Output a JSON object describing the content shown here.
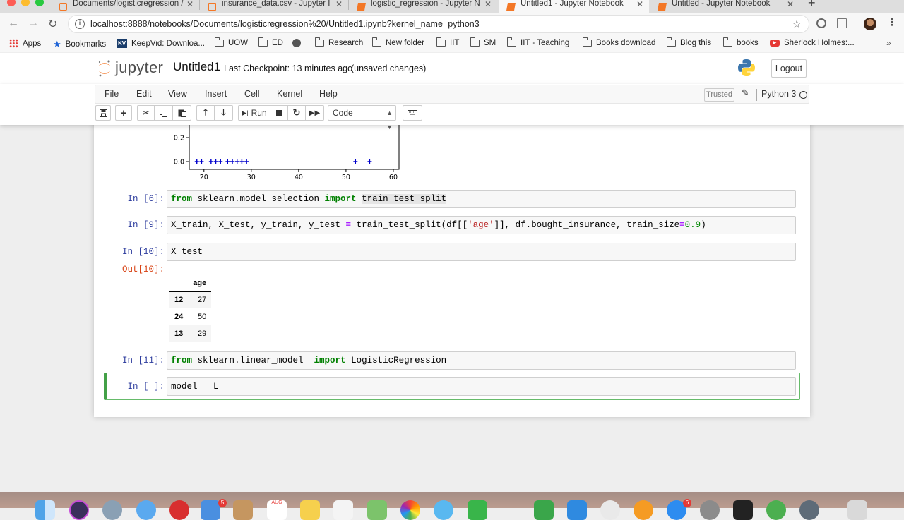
{
  "browser": {
    "tabs": [
      {
        "title": "Documents/logisticregression /",
        "active": false
      },
      {
        "title": "insurance_data.csv - Jupyter I",
        "active": false
      },
      {
        "title": "logistic_regression - Jupyter N",
        "active": false
      },
      {
        "title": "Untitled1 - Jupyter Notebook",
        "active": true
      },
      {
        "title": "Untitled - Jupyter Notebook",
        "active": false
      }
    ],
    "url": "localhost:8888/notebooks/Documents/logisticregression%20/Untitled1.ipynb?kernel_name=python3",
    "bookmarks": [
      "Apps",
      "Bookmarks",
      "KeepVid: Downloa...",
      "UOW",
      "ED",
      "Research",
      "New folder",
      "IIT",
      "SM",
      "IIT - Teaching",
      "Books download",
      "Blog this",
      "books",
      "Sherlock Holmes:..."
    ]
  },
  "jupyter": {
    "logo_text": "jupyter",
    "notebook_name": "Untitled1",
    "checkpoint": "Last Checkpoint: 13 minutes ago",
    "autosave": "(unsaved changes)",
    "logout": "Logout",
    "menu": [
      "File",
      "Edit",
      "View",
      "Insert",
      "Cell",
      "Kernel",
      "Help"
    ],
    "trusted": "Trusted",
    "kernel": "Python 3",
    "toolbar": {
      "run_label": "Run",
      "cell_type": "Code"
    }
  },
  "plot_axis": {
    "x_ticks": [
      "20",
      "30",
      "40",
      "50",
      "60"
    ],
    "y_ticks": [
      "0.2",
      "0.0"
    ],
    "points_x": [
      18.5,
      19.5,
      21.5,
      22.5,
      23.5,
      25,
      26,
      27,
      28,
      29,
      52,
      55
    ],
    "points_y": [
      0,
      0,
      0,
      0,
      0,
      0,
      0,
      0,
      0,
      0,
      0,
      0
    ],
    "marker_color": "#0000cc"
  },
  "cells": {
    "c6": {
      "prompt": "In [6]:"
    },
    "c9": {
      "prompt": "In [9]:"
    },
    "c10": {
      "prompt": "In [10]:",
      "code": "X_test",
      "out_prompt": "Out[10]:"
    },
    "c11": {
      "prompt": "In [11]:"
    },
    "c_new": {
      "prompt": "In [ ]:",
      "code": "model = L"
    }
  },
  "code_text": {
    "c6": {
      "kw1": "from",
      "mod": " sklearn.model_selection ",
      "kw2": "import",
      "sp": " ",
      "name": "train_test_split"
    },
    "c9": {
      "a": "X_train, X_test, y_train, y_test ",
      "eq": "=",
      "b": " train_test_split(df[[",
      "s": "'age'",
      "c": "]], df.bought_insurance, train_size",
      "eq2": "=",
      "n": "0.9",
      "d": ")"
    },
    "c11": {
      "kw1": "from",
      "mod": " sklearn.linear_model  ",
      "kw2": "import",
      "name": " LogisticRegression"
    }
  },
  "dataframe": {
    "columns": [
      "",
      "age"
    ],
    "rows": [
      {
        "index": "12",
        "age": "27"
      },
      {
        "index": "24",
        "age": "50"
      },
      {
        "index": "13",
        "age": "29"
      }
    ]
  },
  "dock": {
    "badges": [
      "5",
      "6"
    ],
    "calendar_month": "AUG"
  }
}
